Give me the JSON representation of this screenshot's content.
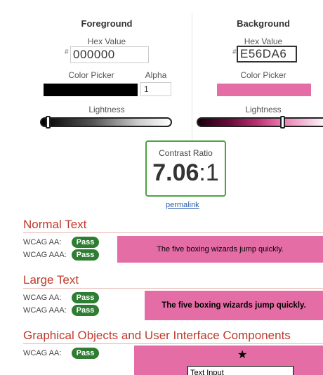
{
  "foreground": {
    "heading": "Foreground",
    "hex_label": "Hex Value",
    "hash": "#",
    "hex_value": "000000",
    "picker_label": "Color Picker",
    "alpha_label": "Alpha",
    "alpha_value": "1",
    "lightness_label": "Lightness",
    "color": "#000000",
    "lightness": 0.0
  },
  "background": {
    "heading": "Background",
    "hex_label": "Hex Value",
    "hash": "#",
    "hex_value": "E56DA6",
    "picker_label": "Color Picker",
    "lightness_label": "Lightness",
    "color": "#e56da6",
    "lightness": 0.64
  },
  "contrast": {
    "label": "Contrast Ratio",
    "value": "7.06",
    "suffix": ":1",
    "border_color": "#49a53f"
  },
  "permalink": "permalink",
  "normal_text": {
    "title": "Normal Text",
    "aa_label": "WCAG AA:",
    "aa_result": "Pass",
    "aaa_label": "WCAG AAA:",
    "aaa_result": "Pass",
    "sample": "The five boxing wizards jump quickly."
  },
  "large_text": {
    "title": "Large Text",
    "aa_label": "WCAG AA:",
    "aa_result": "Pass",
    "aaa_label": "WCAG AAA:",
    "aaa_result": "Pass",
    "sample": "The five boxing wizards jump quickly."
  },
  "graphical": {
    "title": "Graphical Objects and User Interface Components",
    "aa_label": "WCAG AA:",
    "aa_result": "Pass",
    "input_value": "Text Input",
    "icon": "star-icon"
  },
  "colors": {
    "section_title": "#c0392b",
    "pass_badge": "#2e7d32",
    "link": "#2a5db0"
  }
}
